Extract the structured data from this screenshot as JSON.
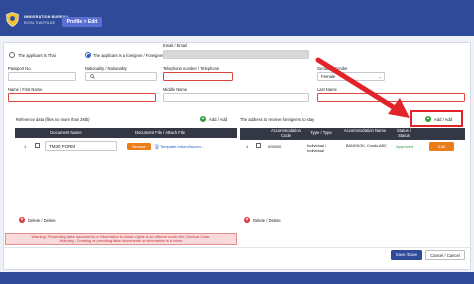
{
  "header": {
    "brand_line1": "IMMIGRATION BUREAU",
    "brand_line2": "ROYAL THAI POLICE",
    "profile_button": "Profile > Edit"
  },
  "form": {
    "radio_thai": "The applicant is Thai",
    "radio_foreigner": "The applicant is a foreigner / Foreigner",
    "email_label": "Email / Email",
    "passport_label": "Passport No.",
    "nationality_label": "Nationality / Nationality",
    "phone_label": "Telephone number / Telephone",
    "gender_label": "Gender / Gender",
    "gender_value": "Female",
    "firstname_label": "Name / First Name",
    "middlename_label": "Middle Name",
    "lastname_label": "Last Name"
  },
  "reference": {
    "title": "Reference data (files no more than 2Mb)",
    "add_label": "Add / Add",
    "columns": [
      "Document Name",
      "Document File / Attach File"
    ],
    "rows": [
      {
        "number": "1",
        "document_name": "TM30 FORM",
        "browse_label": "Browse",
        "file_name": "Template-inform/tocom..."
      }
    ],
    "delete_label": "Delete / Delete"
  },
  "address": {
    "title": "The address to receive foreigners to stay",
    "add_label": "Add / Add",
    "columns": [
      "Accommodation Code",
      "Type / Type",
      "Accommodation Name",
      "Status / Status"
    ],
    "rows": [
      {
        "number": "1",
        "code": "000000",
        "type": "Individual / Individual",
        "name": "BANGKOK, Condo ABC",
        "status": "Approved",
        "edit_label": "Edit"
      }
    ],
    "delete_label": "Delete / Delete"
  },
  "warning": {
    "line1": "Warning: Presenting false documents or information to obtain rights is an offense under the Criminal Code.",
    "line2": "Warning : Creating or providing false documents or information is a crime"
  },
  "actions": {
    "save_label": "Save /Save",
    "cancel_label": "Cancel / Cancel"
  },
  "colors": {
    "header_bg": "#2e4a98",
    "accent_orange": "#ec7d19",
    "success_green": "#2f9d3b",
    "error_red": "#e0242a"
  }
}
